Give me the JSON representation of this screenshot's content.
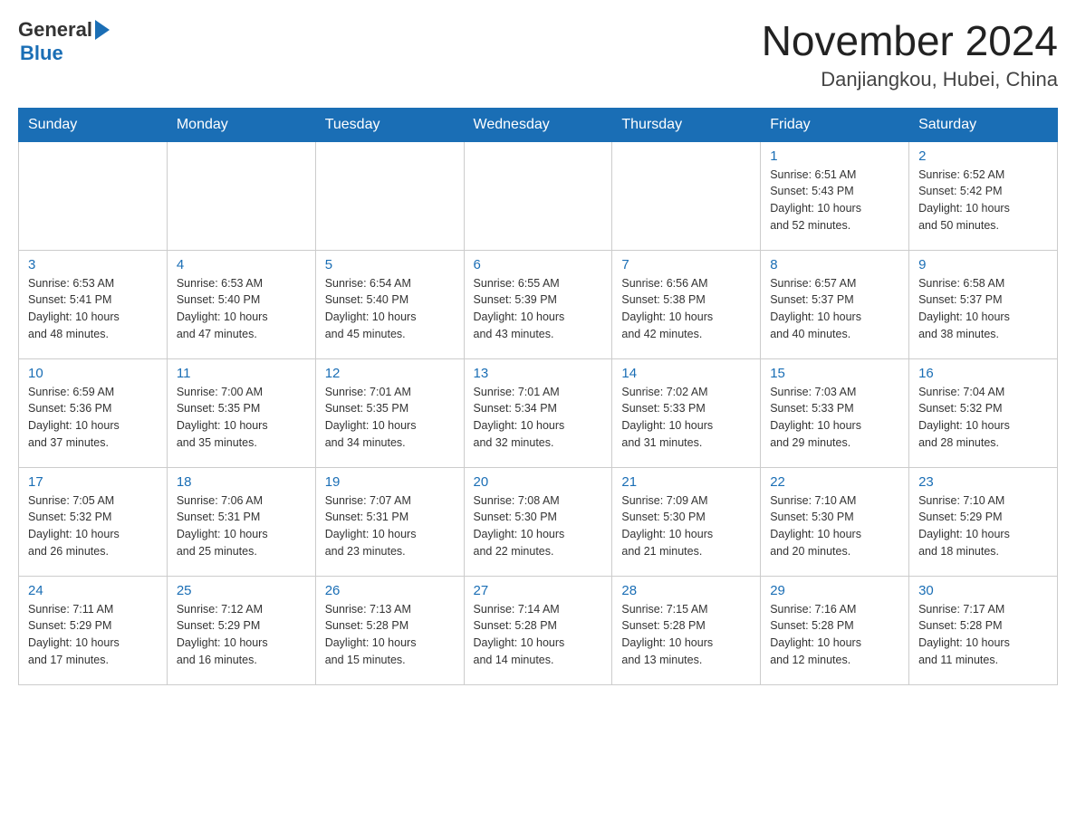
{
  "header": {
    "logo_general": "General",
    "logo_blue": "Blue",
    "title": "November 2024",
    "subtitle": "Danjiangkou, Hubei, China"
  },
  "days_of_week": [
    "Sunday",
    "Monday",
    "Tuesday",
    "Wednesday",
    "Thursday",
    "Friday",
    "Saturday"
  ],
  "weeks": [
    {
      "days": [
        {
          "number": "",
          "info": ""
        },
        {
          "number": "",
          "info": ""
        },
        {
          "number": "",
          "info": ""
        },
        {
          "number": "",
          "info": ""
        },
        {
          "number": "",
          "info": ""
        },
        {
          "number": "1",
          "info": "Sunrise: 6:51 AM\nSunset: 5:43 PM\nDaylight: 10 hours\nand 52 minutes."
        },
        {
          "number": "2",
          "info": "Sunrise: 6:52 AM\nSunset: 5:42 PM\nDaylight: 10 hours\nand 50 minutes."
        }
      ]
    },
    {
      "days": [
        {
          "number": "3",
          "info": "Sunrise: 6:53 AM\nSunset: 5:41 PM\nDaylight: 10 hours\nand 48 minutes."
        },
        {
          "number": "4",
          "info": "Sunrise: 6:53 AM\nSunset: 5:40 PM\nDaylight: 10 hours\nand 47 minutes."
        },
        {
          "number": "5",
          "info": "Sunrise: 6:54 AM\nSunset: 5:40 PM\nDaylight: 10 hours\nand 45 minutes."
        },
        {
          "number": "6",
          "info": "Sunrise: 6:55 AM\nSunset: 5:39 PM\nDaylight: 10 hours\nand 43 minutes."
        },
        {
          "number": "7",
          "info": "Sunrise: 6:56 AM\nSunset: 5:38 PM\nDaylight: 10 hours\nand 42 minutes."
        },
        {
          "number": "8",
          "info": "Sunrise: 6:57 AM\nSunset: 5:37 PM\nDaylight: 10 hours\nand 40 minutes."
        },
        {
          "number": "9",
          "info": "Sunrise: 6:58 AM\nSunset: 5:37 PM\nDaylight: 10 hours\nand 38 minutes."
        }
      ]
    },
    {
      "days": [
        {
          "number": "10",
          "info": "Sunrise: 6:59 AM\nSunset: 5:36 PM\nDaylight: 10 hours\nand 37 minutes."
        },
        {
          "number": "11",
          "info": "Sunrise: 7:00 AM\nSunset: 5:35 PM\nDaylight: 10 hours\nand 35 minutes."
        },
        {
          "number": "12",
          "info": "Sunrise: 7:01 AM\nSunset: 5:35 PM\nDaylight: 10 hours\nand 34 minutes."
        },
        {
          "number": "13",
          "info": "Sunrise: 7:01 AM\nSunset: 5:34 PM\nDaylight: 10 hours\nand 32 minutes."
        },
        {
          "number": "14",
          "info": "Sunrise: 7:02 AM\nSunset: 5:33 PM\nDaylight: 10 hours\nand 31 minutes."
        },
        {
          "number": "15",
          "info": "Sunrise: 7:03 AM\nSunset: 5:33 PM\nDaylight: 10 hours\nand 29 minutes."
        },
        {
          "number": "16",
          "info": "Sunrise: 7:04 AM\nSunset: 5:32 PM\nDaylight: 10 hours\nand 28 minutes."
        }
      ]
    },
    {
      "days": [
        {
          "number": "17",
          "info": "Sunrise: 7:05 AM\nSunset: 5:32 PM\nDaylight: 10 hours\nand 26 minutes."
        },
        {
          "number": "18",
          "info": "Sunrise: 7:06 AM\nSunset: 5:31 PM\nDaylight: 10 hours\nand 25 minutes."
        },
        {
          "number": "19",
          "info": "Sunrise: 7:07 AM\nSunset: 5:31 PM\nDaylight: 10 hours\nand 23 minutes."
        },
        {
          "number": "20",
          "info": "Sunrise: 7:08 AM\nSunset: 5:30 PM\nDaylight: 10 hours\nand 22 minutes."
        },
        {
          "number": "21",
          "info": "Sunrise: 7:09 AM\nSunset: 5:30 PM\nDaylight: 10 hours\nand 21 minutes."
        },
        {
          "number": "22",
          "info": "Sunrise: 7:10 AM\nSunset: 5:30 PM\nDaylight: 10 hours\nand 20 minutes."
        },
        {
          "number": "23",
          "info": "Sunrise: 7:10 AM\nSunset: 5:29 PM\nDaylight: 10 hours\nand 18 minutes."
        }
      ]
    },
    {
      "days": [
        {
          "number": "24",
          "info": "Sunrise: 7:11 AM\nSunset: 5:29 PM\nDaylight: 10 hours\nand 17 minutes."
        },
        {
          "number": "25",
          "info": "Sunrise: 7:12 AM\nSunset: 5:29 PM\nDaylight: 10 hours\nand 16 minutes."
        },
        {
          "number": "26",
          "info": "Sunrise: 7:13 AM\nSunset: 5:28 PM\nDaylight: 10 hours\nand 15 minutes."
        },
        {
          "number": "27",
          "info": "Sunrise: 7:14 AM\nSunset: 5:28 PM\nDaylight: 10 hours\nand 14 minutes."
        },
        {
          "number": "28",
          "info": "Sunrise: 7:15 AM\nSunset: 5:28 PM\nDaylight: 10 hours\nand 13 minutes."
        },
        {
          "number": "29",
          "info": "Sunrise: 7:16 AM\nSunset: 5:28 PM\nDaylight: 10 hours\nand 12 minutes."
        },
        {
          "number": "30",
          "info": "Sunrise: 7:17 AM\nSunset: 5:28 PM\nDaylight: 10 hours\nand 11 minutes."
        }
      ]
    }
  ]
}
